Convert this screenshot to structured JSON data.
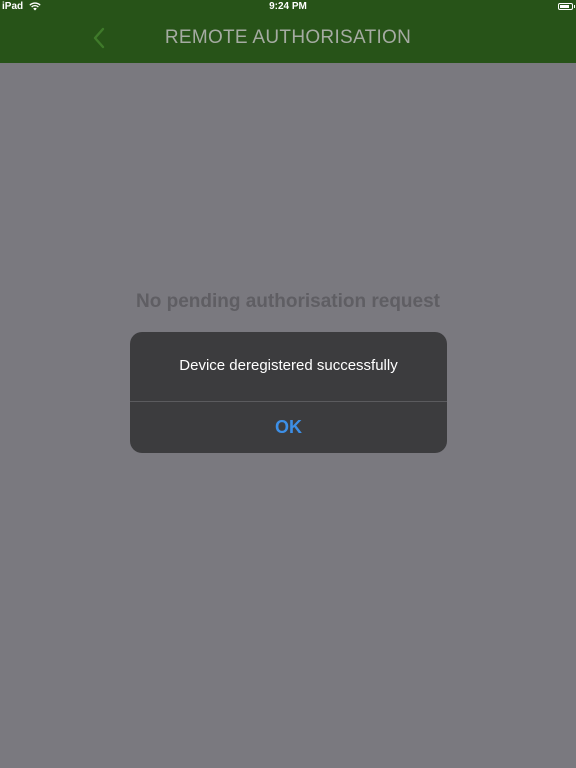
{
  "status_bar": {
    "device": "iPad",
    "time": "9:24 PM",
    "wifi_icon": "wifi-icon",
    "battery_icon": "battery-icon"
  },
  "nav": {
    "title": "REMOTE AUTHORISATION",
    "back_icon": "chevron-left-icon",
    "background_color": "#275318"
  },
  "main": {
    "empty_message": "No pending authorisation request"
  },
  "alert": {
    "message": "Device deregistered successfully",
    "ok_label": "OK",
    "ok_color": "#3d8fe6"
  }
}
